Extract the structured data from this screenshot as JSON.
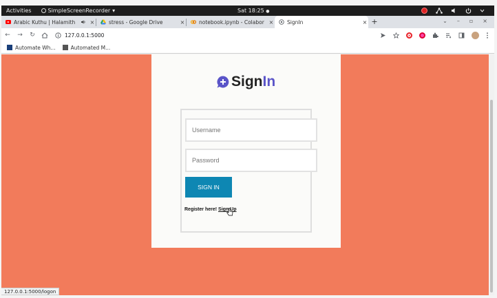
{
  "topbar": {
    "activities": "Activities",
    "app_name": "SimpleScreenRecorder",
    "app_caret": "▾",
    "clock": "Sat 18:25",
    "clock_dot": "●"
  },
  "tabs": [
    {
      "label": "Arabic Kuthu | Halamith",
      "close": "×",
      "favicon_color": "#ff0000"
    },
    {
      "label": "stress - Google Drive",
      "close": "×",
      "favicon_color": "#1fa463"
    },
    {
      "label": "notebook.ipynb - Colabor",
      "close": "×",
      "favicon_color": "#f9ab00"
    },
    {
      "label": "SignIn",
      "close": "×",
      "favicon_color": "#5f6368"
    }
  ],
  "newtab_label": "+",
  "window_controls": [
    "⌄",
    "–",
    "▫",
    "×"
  ],
  "toolbar": {
    "url": "127.0.0.1:5000"
  },
  "bookmarks": [
    {
      "label": "Automate Wh..."
    },
    {
      "label": "Automated M..."
    }
  ],
  "page": {
    "background": "#f27b5b",
    "title_sign": "Sign",
    "title_in": "In",
    "title_accent": "#5a54c8",
    "username_placeholder": "Username",
    "password_placeholder": "Password",
    "button_label": "SIGN IN",
    "button_color": "#0e87b3",
    "register_text": "Register here! ",
    "register_link": "Sign Up"
  },
  "status_url": "127.0.0.1:5000/logon"
}
